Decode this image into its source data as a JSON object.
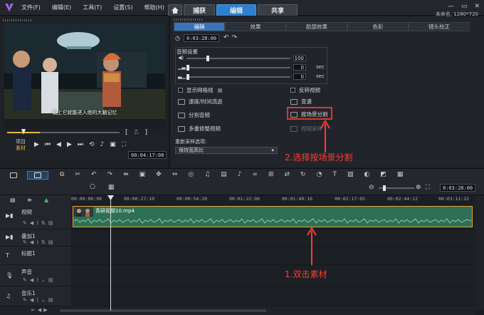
{
  "menu": [
    "文件(F)",
    "编辑(E)",
    "工具(T)",
    "设置(S)",
    "帮助(H)"
  ],
  "main_tabs": [
    {
      "label": "",
      "icon": "home-icon"
    },
    {
      "label": "捕获"
    },
    {
      "label": "编辑",
      "active": true
    },
    {
      "label": "共享"
    }
  ],
  "project_info": "未命名, 1280*720",
  "preview": {
    "subtitle": "戴上它就能进入他的大脑记忆",
    "mode_project": "项目",
    "mode_clip": "素材",
    "timecode": "00:04:17:08"
  },
  "options_tabs": [
    "编辑",
    "效果",
    "脸部效果",
    "色彩",
    "镜头校正"
  ],
  "duration": "0:03:28:00",
  "audio": {
    "title": "音频设置",
    "volume": "100",
    "fade_in": "0",
    "fade_out": "0",
    "unit": "sec"
  },
  "options": {
    "show_grid": "显示网格线",
    "reverse": "反转视频",
    "speed_time": "速度/时间流逝",
    "variable_speed": "变速",
    "split_audio": "分割音频",
    "split_by_scene": "按场景分割",
    "multi_trim": "多重修整视频",
    "sampling": "视频采样",
    "resample_label": "重新采样选项:",
    "resample_value": "保持宽高比"
  },
  "annotations": {
    "step2": "2.选择按场景分割",
    "step1": "1.双击素材"
  },
  "timeline": {
    "timecode": "0:03:28:00",
    "ruler": [
      "00:00:00:00",
      "00:00:27:10",
      "00:00:54:20",
      "00:01:22:06",
      "00:01:49:16",
      "00:02:17:02",
      "00:02:44:12",
      "00:03:11:22"
    ],
    "tracks": [
      {
        "name": "视频",
        "type": "video"
      },
      {
        "name": "叠加1",
        "type": "overlay"
      },
      {
        "name": "标题1",
        "type": "title"
      },
      {
        "name": "声音",
        "type": "voice"
      },
      {
        "name": "音乐1",
        "type": "music"
      }
    ],
    "clip_name": "青研视频10.mp4"
  },
  "colors": {
    "accent": "#2f7fd0",
    "annotation": "#ff3d2f",
    "clip": "#2f6f55"
  }
}
